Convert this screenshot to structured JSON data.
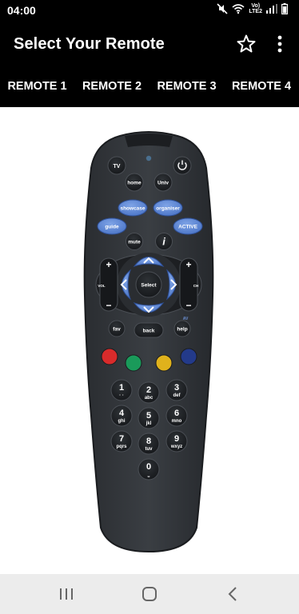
{
  "status_bar": {
    "time": "04:00",
    "network_label_top": "Vo)",
    "network_label_bottom": "LTE2"
  },
  "app_bar": {
    "title": "Select Your Remote"
  },
  "tabs": [
    {
      "label": "REMOTE 1"
    },
    {
      "label": "REMOTE 2"
    },
    {
      "label": "REMOTE 3"
    },
    {
      "label": "REMOTE 4"
    }
  ],
  "remote": {
    "tv": "TV",
    "home": "home",
    "univ": "Univ",
    "showcase": "showcase",
    "organiser": "organiser",
    "guide": "guide",
    "active": "ACTIVE",
    "mute": "mute",
    "info": "i",
    "vol_plus": "+",
    "vol_minus": "−",
    "vol": "VOL",
    "ch_plus": "+",
    "ch_minus": "−",
    "ch": "CH",
    "select": "Select",
    "fav": "fav",
    "back": "back",
    "help": "help",
    "av": "AV",
    "keypad": [
      {
        "digit": "1",
        "letters": "· ·"
      },
      {
        "digit": "2",
        "letters": "abc"
      },
      {
        "digit": "3",
        "letters": "def"
      },
      {
        "digit": "4",
        "letters": "ghi"
      },
      {
        "digit": "5",
        "letters": "jkl"
      },
      {
        "digit": "6",
        "letters": "mno"
      },
      {
        "digit": "7",
        "letters": "pqrs"
      },
      {
        "digit": "8",
        "letters": "tuv"
      },
      {
        "digit": "9",
        "letters": "wxyz"
      },
      {
        "digit": "0",
        "letters": "⎵"
      }
    ],
    "colors": {
      "red": "#d92b2b",
      "green": "#1a9a5a",
      "yellow": "#e0b21c",
      "blue": "#233a8a",
      "accent_blue": "#5b86d6"
    }
  }
}
